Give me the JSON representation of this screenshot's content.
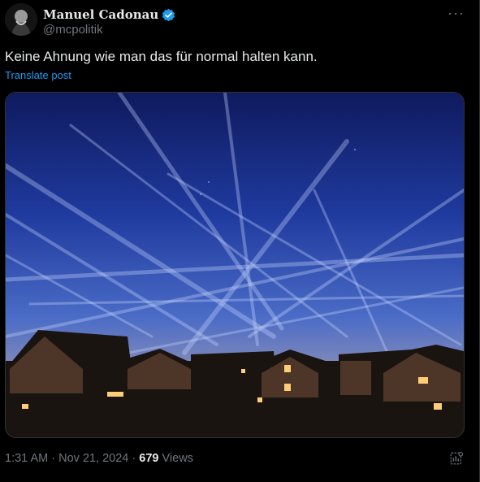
{
  "author": {
    "name": "Manuel Cadonau",
    "handle": "@mcpolitik",
    "verified": true
  },
  "post": {
    "text": "Keine Ahnung wie man das für normal halten kann.",
    "translate_label": "Translate post"
  },
  "meta": {
    "time": "1:31 AM",
    "separator": "·",
    "date": "Nov 21, 2024",
    "views_count": "679",
    "views_label": "Views"
  },
  "icons": {
    "more": "more-options-icon",
    "verified": "verified-badge-icon",
    "analytics": "analytics-icon"
  },
  "colors": {
    "background": "#000000",
    "text": "#e7e9ea",
    "muted": "#71767b",
    "link": "#1d9bf0"
  }
}
